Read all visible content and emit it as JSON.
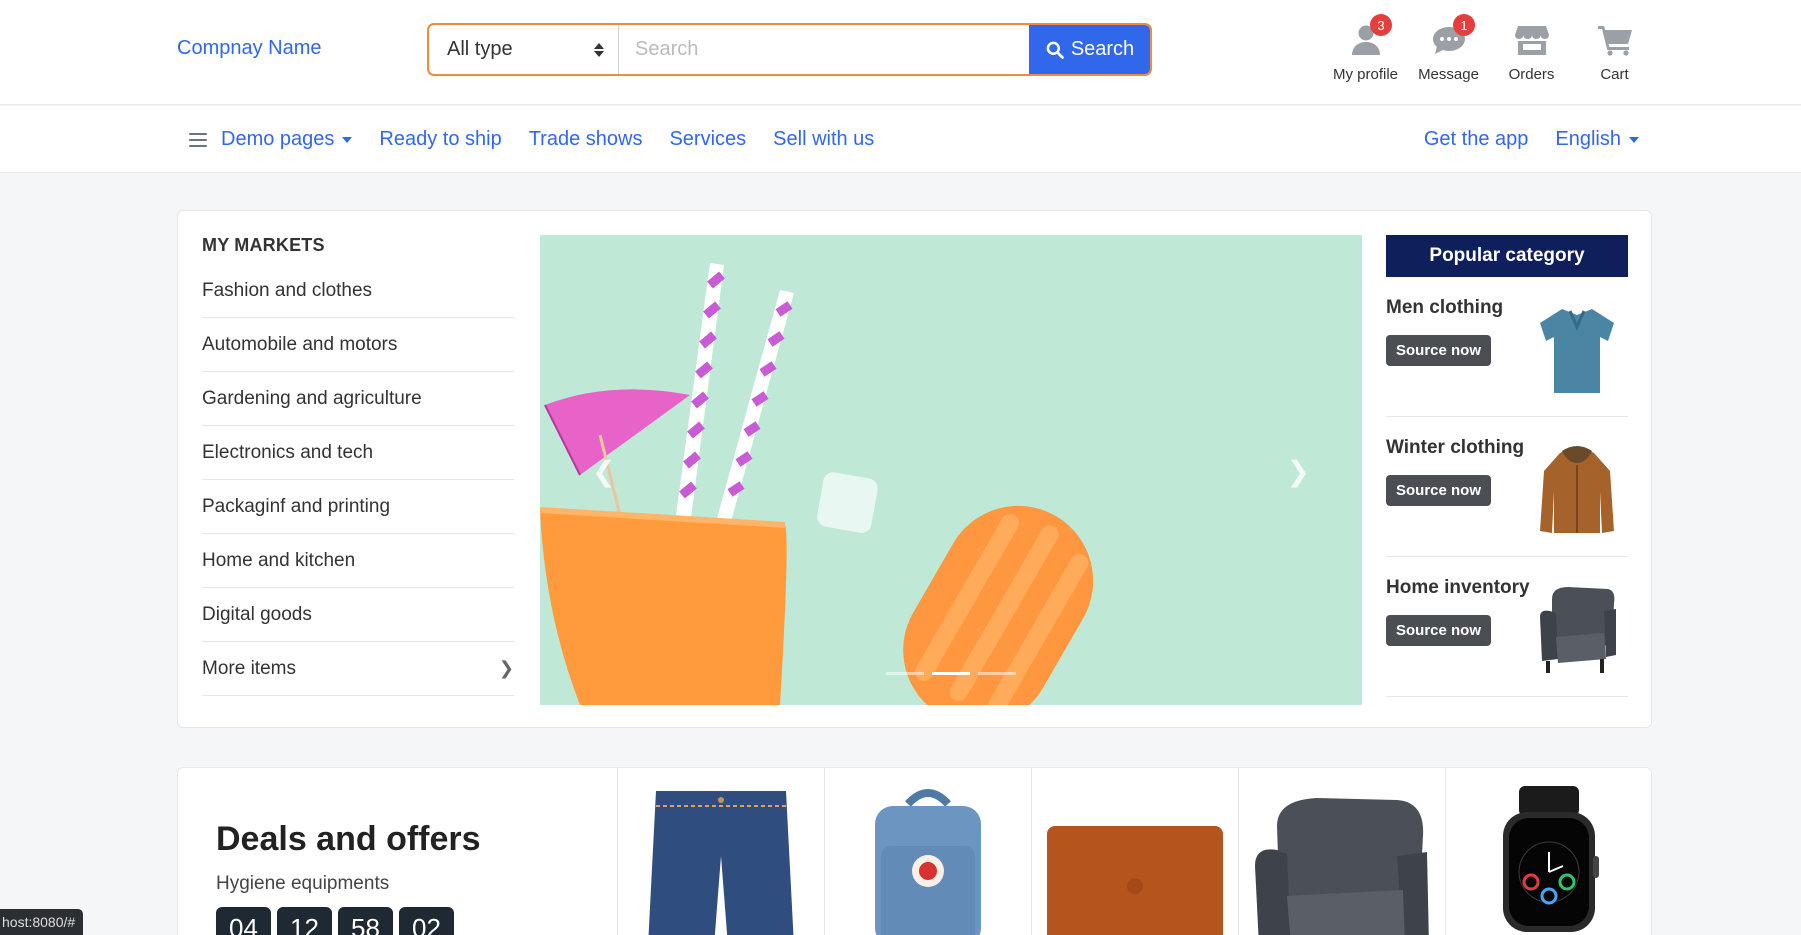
{
  "header": {
    "brand": "Compnay Name",
    "search": {
      "type_value": "All type",
      "placeholder": "Search",
      "button_label": "Search"
    },
    "widgets": [
      {
        "label": "My profile",
        "icon": "user-icon",
        "badge": "3"
      },
      {
        "label": "Message",
        "icon": "message-icon",
        "badge": "1"
      },
      {
        "label": "Orders",
        "icon": "store-icon",
        "badge": ""
      },
      {
        "label": "Cart",
        "icon": "cart-icon",
        "badge": ""
      }
    ]
  },
  "nav": {
    "demo_pages": "Demo pages",
    "ready_to_ship": "Ready to ship",
    "trade_shows": "Trade shows",
    "services": "Services",
    "sell_with_us": "Sell with us",
    "get_the_app": "Get the app",
    "language": "English"
  },
  "markets": {
    "heading": "MY MARKETS",
    "items": [
      "Fashion and clothes",
      "Automobile and motors",
      "Gardening and agriculture",
      "Electronics and tech",
      "Packaginf and printing",
      "Home and kitchen",
      "Digital goods",
      "More items"
    ]
  },
  "slider": {
    "slide_count": 3,
    "active_index": 1
  },
  "popular": {
    "heading": "Popular category",
    "items": [
      {
        "title": "Men clothing",
        "button": "Source now"
      },
      {
        "title": "Winter clothing",
        "button": "Source now"
      },
      {
        "title": "Home inventory",
        "button": "Source now"
      }
    ]
  },
  "deals": {
    "title": "Deals and offers",
    "subtitle": "Hygiene equipments",
    "timer": [
      "04",
      "12",
      "58",
      "02"
    ]
  },
  "status_bar": "host:8080/#",
  "colors": {
    "accent": "#3167eb",
    "navy": "#0f1f5c",
    "badge": "#e53e3e",
    "search_border": "#f08a3c"
  }
}
